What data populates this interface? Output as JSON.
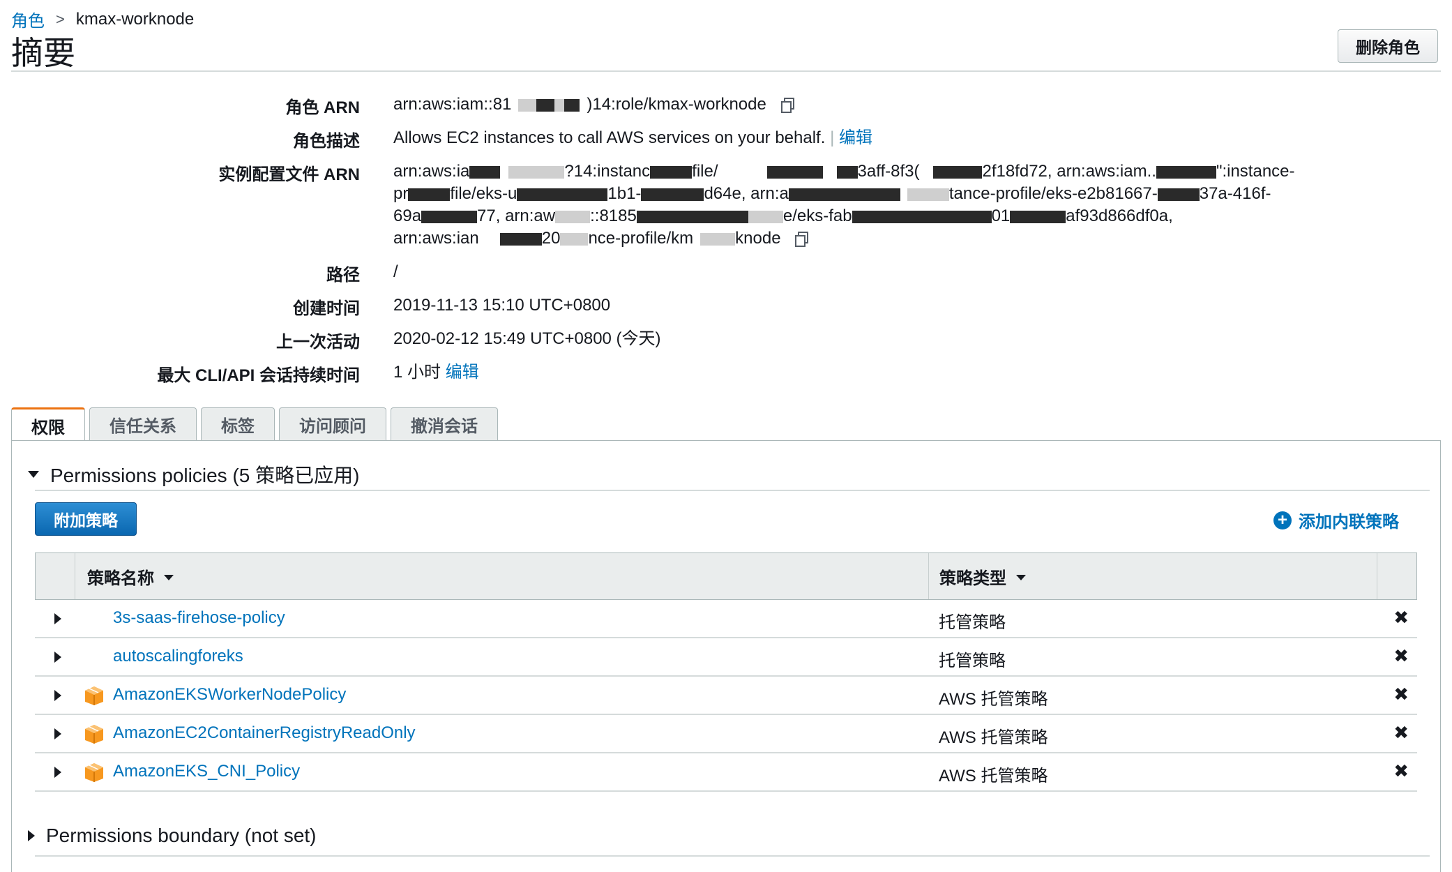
{
  "breadcrumb": {
    "parent": "角色",
    "separator": ">",
    "current": "kmax-worknode"
  },
  "page_title": "摘要",
  "delete_button": "删除角色",
  "summary": {
    "role_arn": {
      "label": "角色 ARN",
      "prefix": "arn:aws:iam::81",
      "suffix": ")14:role/kmax-worknode"
    },
    "description": {
      "label": "角色描述",
      "text": "Allows EC2 instances to call AWS services on your behalf.",
      "divider": "|",
      "edit": "编辑"
    },
    "instance_profile": {
      "label": "实例配置文件 ARN",
      "line1a": "arn:aws:ia",
      "line1b": "?14:instanc",
      "line1c": "file/",
      "line1d": "3aff-8f3(",
      "line1e": "2f18fd72, arn:aws:iam..",
      "line1f": "\":instance-",
      "line2a": "pr",
      "line2b": "file/eks-u",
      "line2c": "1b1-",
      "line2d": "d64e, arn:a",
      "line2e": "tance-profile/eks-e2b81667-",
      "line2f": "37a-416f-",
      "line3a": "69a",
      "line3b": "77, arn:aw",
      "line3c": "::8185",
      "line3d": "e/eks-fab",
      "line3e": "01",
      "line3f": "af93d866df0a,",
      "line4a": "arn:aws:ian",
      "line4b": "20",
      "line4c": "nce-profile/km",
      "line4d": "knode"
    },
    "path": {
      "label": "路径",
      "value": "/"
    },
    "created": {
      "label": "创建时间",
      "value": "2019-11-13 15:10 UTC+0800"
    },
    "last_activity": {
      "label": "上一次活动",
      "value": "2020-02-12 15:49 UTC+0800 (今天)"
    },
    "max_session": {
      "label": "最大 CLI/API 会话持续时间",
      "value": "1 小时",
      "edit": "编辑"
    }
  },
  "tabs": [
    "权限",
    "信任关系",
    "标签",
    "访问顾问",
    "撤消会话"
  ],
  "permissions": {
    "title": "Permissions policies (5 策略已应用)",
    "attach_button": "附加策略",
    "add_inline": "添加内联策略",
    "columns": {
      "name": "策略名称",
      "type": "策略类型"
    },
    "rows": [
      {
        "name": "3s-saas-firehose-policy",
        "type": "托管策略",
        "aws_icon": false
      },
      {
        "name": "autoscalingforeks",
        "type": "托管策略",
        "aws_icon": false
      },
      {
        "name": "AmazonEKSWorkerNodePolicy",
        "type": "AWS 托管策略",
        "aws_icon": true
      },
      {
        "name": "AmazonEC2ContainerRegistryReadOnly",
        "type": "AWS 托管策略",
        "aws_icon": true
      },
      {
        "name": "AmazonEKS_CNI_Policy",
        "type": "AWS 托管策略",
        "aws_icon": true
      }
    ],
    "remove_glyph": "✖"
  },
  "boundary": {
    "title": "Permissions boundary (not set)"
  },
  "colors": {
    "link": "#0073bb",
    "active_tab_accent": "#ec7211",
    "primary_button": "#0a67b0",
    "aws_box_icon": "#f7981f"
  }
}
